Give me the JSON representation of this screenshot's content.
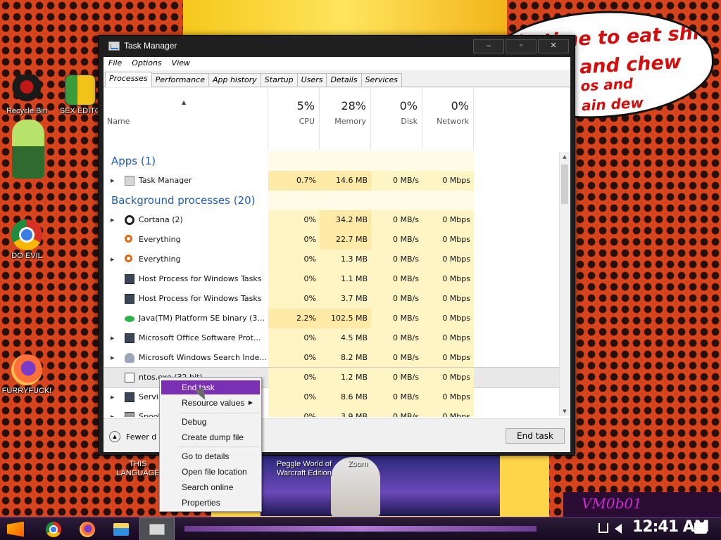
{
  "desktop": {
    "speech_lines": [
      "it's time to eat shit",
      "and chew",
      "os and",
      "ain dew"
    ],
    "icons": [
      {
        "label": "Recycle Bin"
      },
      {
        "label": "SEX EDITO"
      },
      {
        "label": "DO EVIL"
      },
      {
        "label": "FURRYFUCK!"
      }
    ],
    "label_this_language": "THIS\nLANGUAGE",
    "label_peggle": "Peggle World of\nWarcraft Edition",
    "label_zoom": "Zoom",
    "signature": "VM0b01"
  },
  "window": {
    "title": "Task Manager",
    "controls": [
      "–",
      "▫",
      "✕"
    ]
  },
  "menu": [
    "File",
    "Options",
    "View"
  ],
  "tabs": [
    "Processes",
    "Performance",
    "App history",
    "Startup",
    "Users",
    "Details",
    "Services"
  ],
  "columns": {
    "name": "Name",
    "cpu": {
      "pct": "5%",
      "label": "CPU"
    },
    "memory": {
      "pct": "28%",
      "label": "Memory"
    },
    "disk": {
      "pct": "0%",
      "label": "Disk"
    },
    "network": {
      "pct": "0%",
      "label": "Network"
    }
  },
  "groups": {
    "apps": "Apps (1)",
    "background": "Background processes (20)"
  },
  "apps": [
    {
      "name": "Task Manager",
      "cpu": "0.7%",
      "mem": "14.6 MB",
      "disk": "0 MB/s",
      "net": "0 Mbps",
      "icon": "task-manager-icon"
    }
  ],
  "background": [
    {
      "name": "Cortana (2)",
      "cpu": "0%",
      "mem": "34.2 MB",
      "disk": "0 MB/s",
      "net": "0 Mbps",
      "icon": "cortana-icon"
    },
    {
      "name": "Everything",
      "cpu": "0%",
      "mem": "22.7 MB",
      "disk": "0 MB/s",
      "net": "0 Mbps",
      "icon": "everything-icon"
    },
    {
      "name": "Everything",
      "cpu": "0%",
      "mem": "1.3 MB",
      "disk": "0 MB/s",
      "net": "0 Mbps",
      "icon": "everything-icon"
    },
    {
      "name": "Host Process for Windows Tasks",
      "cpu": "0%",
      "mem": "1.1 MB",
      "disk": "0 MB/s",
      "net": "0 Mbps",
      "icon": "host-process-icon"
    },
    {
      "name": "Host Process for Windows Tasks",
      "cpu": "0%",
      "mem": "3.7 MB",
      "disk": "0 MB/s",
      "net": "0 Mbps",
      "icon": "host-process-icon"
    },
    {
      "name": "Java(TM) Platform SE binary (3...",
      "cpu": "2.2%",
      "mem": "102.5 MB",
      "disk": "0 MB/s",
      "net": "0 Mbps",
      "icon": "java-icon"
    },
    {
      "name": "Microsoft Office Software Prot...",
      "cpu": "0%",
      "mem": "4.5 MB",
      "disk": "0 MB/s",
      "net": "0 Mbps",
      "icon": "office-icon"
    },
    {
      "name": "Microsoft Windows Search Inde...",
      "cpu": "0%",
      "mem": "8.2 MB",
      "disk": "0 MB/s",
      "net": "0 Mbps",
      "icon": "search-indexer-icon"
    },
    {
      "name": "ntos.exe (32 bit)",
      "cpu": "0%",
      "mem": "1.2 MB",
      "disk": "0 MB/s",
      "net": "0 Mbps",
      "icon": "exe-icon"
    },
    {
      "name": "Servi",
      "cpu": "0%",
      "mem": "8.6 MB",
      "disk": "0 MB/s",
      "net": "0 Mbps",
      "icon": "service-icon"
    },
    {
      "name": "Spool",
      "cpu": "0%",
      "mem": "3.9 MB",
      "disk": "0 MB/s",
      "net": "0 Mbps",
      "icon": "printer-icon"
    }
  ],
  "footer": {
    "fewer_details": "Fewer d",
    "end_task": "End task"
  },
  "context_menu": {
    "items": [
      "End task",
      "Resource values",
      "Debug",
      "Create dump file",
      "Go to details",
      "Open file location",
      "Search online",
      "Properties"
    ],
    "highlight_color": "#7b2fb4"
  },
  "taskbar": {
    "clock": "12:41 AM"
  }
}
